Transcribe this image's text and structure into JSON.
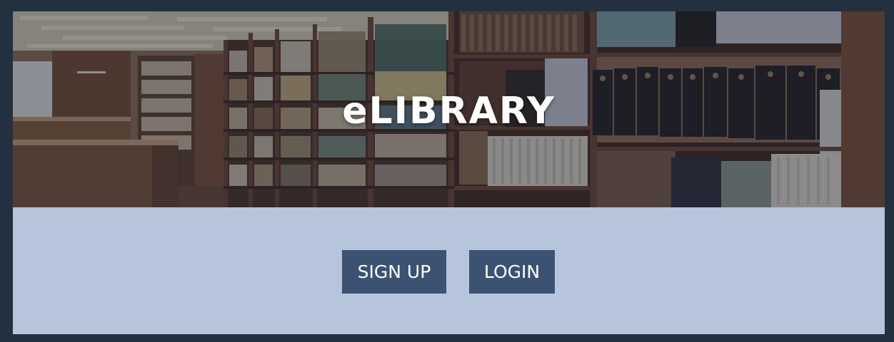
{
  "hero": {
    "title": "eLIBRARY",
    "image": "library-bookshelves-photo"
  },
  "actions": {
    "signup_label": "SIGN UP",
    "login_label": "LOGIN"
  },
  "colors": {
    "frame": "#233040",
    "panel": "#b6c4dc",
    "button": "#3b5272",
    "button_text": "#ffffff"
  }
}
